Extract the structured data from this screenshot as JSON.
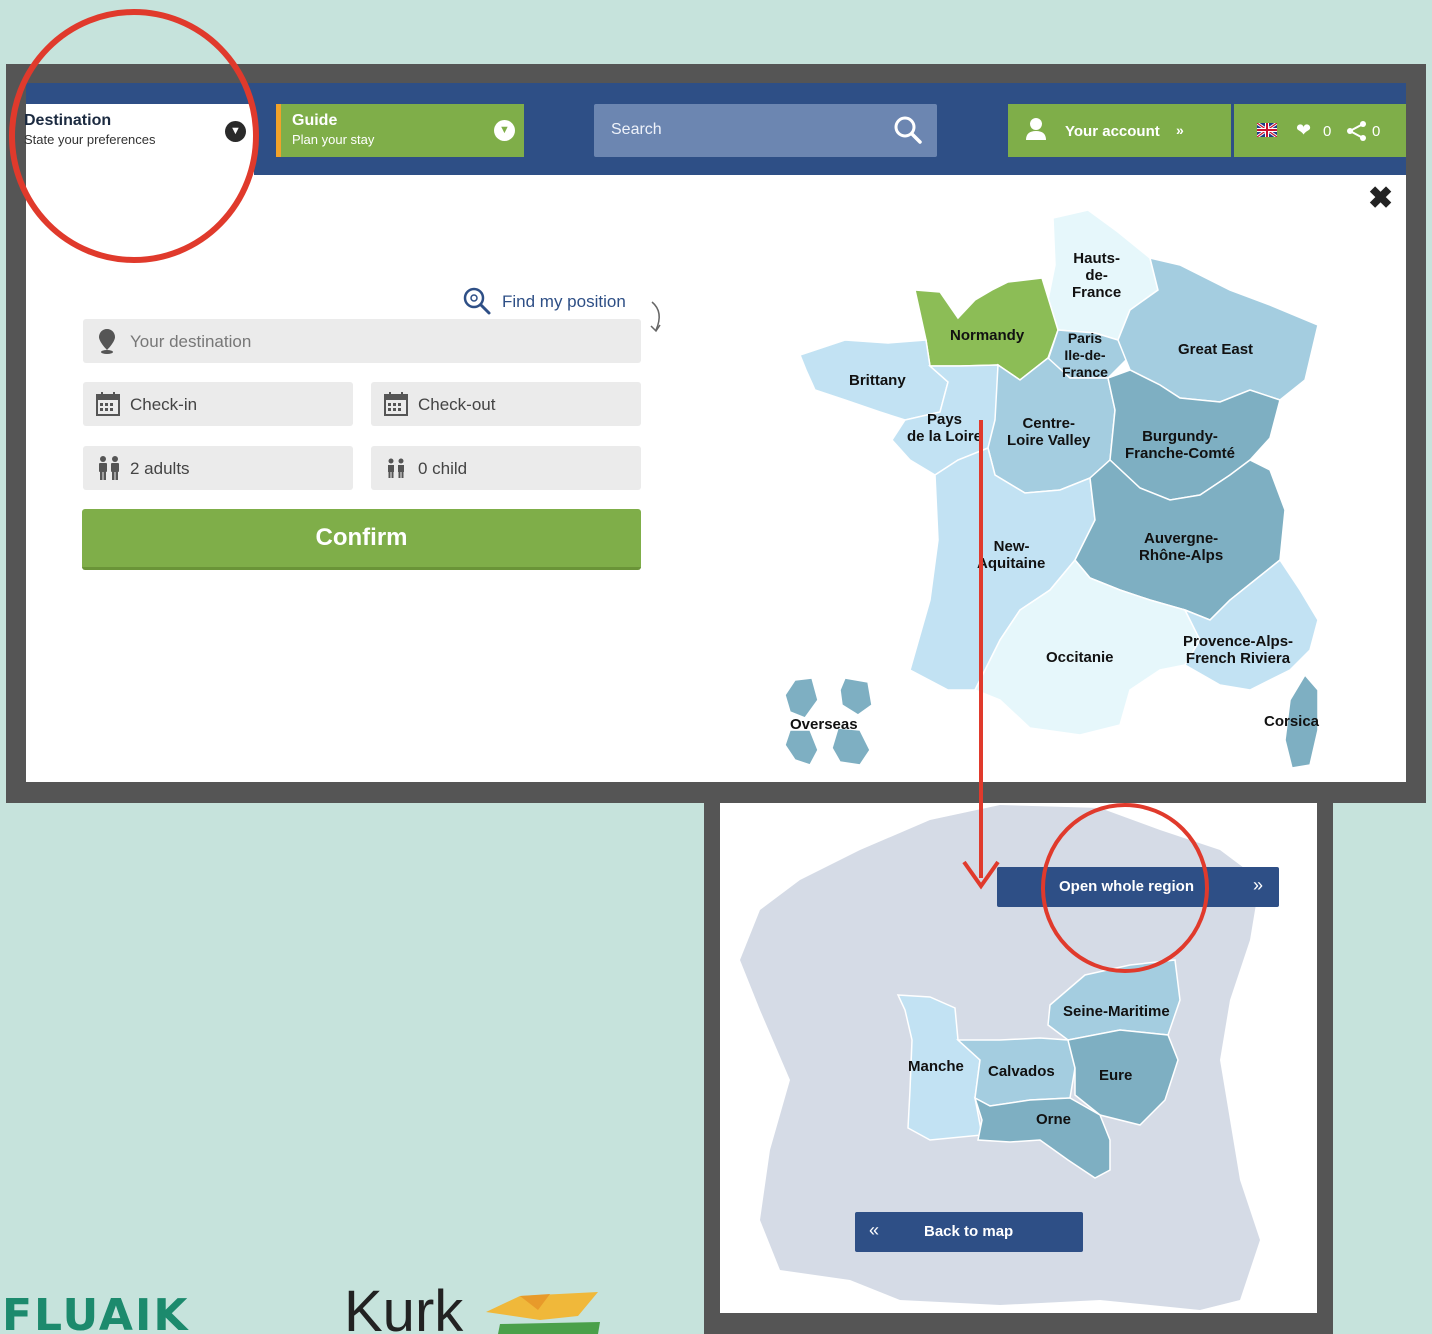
{
  "nav": {
    "destination_title": "Destination",
    "destination_subtitle": "State your preferences",
    "guide_title": "Guide",
    "guide_subtitle": "Plan your stay",
    "search_placeholder": "Search",
    "account_label": "Your account",
    "account_arrow": "»",
    "favorites_count": "0",
    "shares_count": "0"
  },
  "form": {
    "find_position": "Find my position",
    "destination_placeholder": "Your destination",
    "checkin": "Check-in",
    "checkout": "Check-out",
    "adults": "2 adults",
    "children": "0 child",
    "confirm": "Confirm"
  },
  "map": {
    "regions": {
      "hauts_de_france": "Hauts-\nde-\nFrance",
      "normandy": "Normandy",
      "paris": "Paris\nIle-de-\nFrance",
      "great_east": "Great East",
      "brittany": "Brittany",
      "pays_de_la_loire": "Pays\nde la Loire",
      "centre": "Centre-\nLoire Valley",
      "burgundy": "Burgundy-\nFranche-Comté",
      "new_aquitaine": "New-\nAquitaine",
      "auvergne": "Auvergne-\nRhône-Alps",
      "occitanie": "Occitanie",
      "provence": "Provence-Alps-\nFrench Riviera",
      "corsica": "Corsica",
      "overseas": "Overseas"
    },
    "selected_color": "#8cbd56",
    "light_color": "#c2e2f3",
    "mid_color": "#a4cde0",
    "dark_color": "#7eafc2"
  },
  "detail": {
    "open_region": "Open whole region",
    "open_arrow": "»",
    "back_to_map": "Back to map",
    "back_arrow": "«",
    "departments": {
      "seine_maritime": "Seine-Maritime",
      "manche": "Manche",
      "calvados": "Calvados",
      "eure": "Eure",
      "orne": "Orne"
    }
  },
  "logos": {
    "left": "FLUAIK",
    "right": "Kurk"
  },
  "annotation_color": "#e03a2c"
}
